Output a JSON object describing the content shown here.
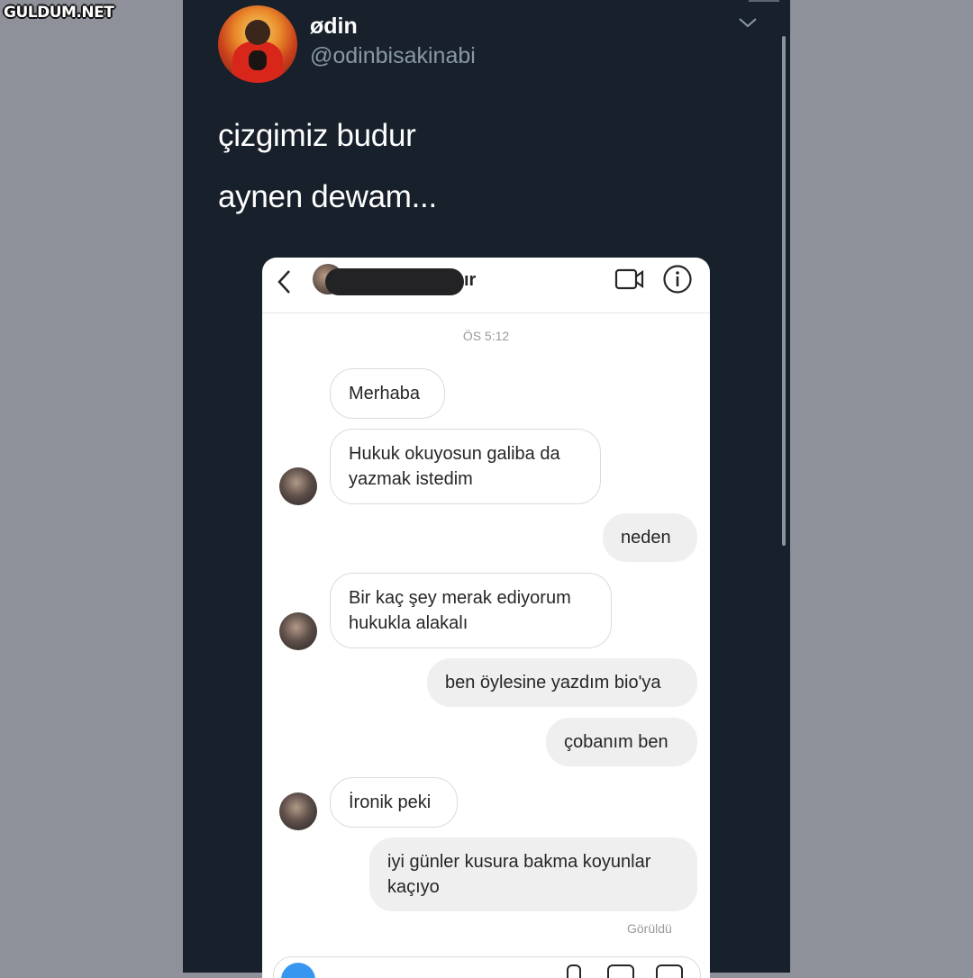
{
  "watermark": "GULDUM.NET",
  "tweet": {
    "display_name": "ødin",
    "handle": "@odinbisakinabi",
    "lines": [
      "çizgimiz budur",
      "aynen dewam..."
    ]
  },
  "dm": {
    "contact_name_suffix": "ır",
    "timestamp": "ÖS 5:12",
    "messages": [
      {
        "side": "in",
        "text": "Merhaba"
      },
      {
        "side": "in",
        "text": "Hukuk okuyosun galiba da yazmak istedim"
      },
      {
        "side": "out",
        "text": "neden"
      },
      {
        "side": "in",
        "text": "Bir kaç şey merak ediyorum hukukla alakalı"
      },
      {
        "side": "out",
        "text": "ben öylesine yazdım bio'ya"
      },
      {
        "side": "out",
        "text": "çobanım ben"
      },
      {
        "side": "in",
        "text": "İronik peki"
      },
      {
        "side": "out",
        "text": "iyi günler kusura bakma koyunlar kaçıyo"
      }
    ],
    "seen_label": "Görüldü"
  },
  "icons": [
    "chevron-down-icon",
    "back-arrow-icon",
    "video-call-icon",
    "info-icon",
    "camera-icon",
    "mic-icon",
    "gallery-icon",
    "sticker-icon"
  ],
  "colors": {
    "tweet_bg": "#17202b",
    "page_bg": "#8e9199",
    "accent_blue": "#3797f0"
  }
}
